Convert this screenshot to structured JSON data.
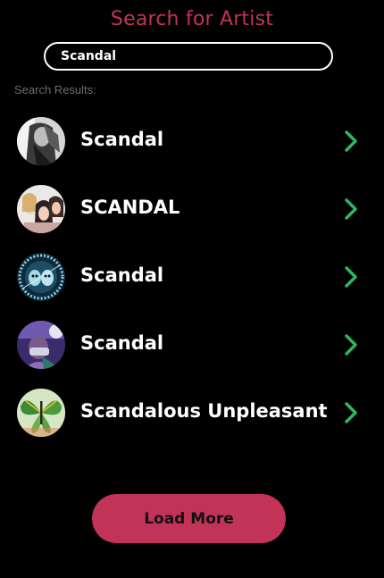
{
  "page_title": "Search for Artist",
  "search": {
    "value": "Scandal"
  },
  "results_label": "Search Results:",
  "results": [
    {
      "name": "Scandal",
      "avatar": "bw-portrait-photo"
    },
    {
      "name": "SCANDAL",
      "avatar": "group-photo"
    },
    {
      "name": "Scandal",
      "avatar": "blue-artwork-photo"
    },
    {
      "name": "Scandal",
      "avatar": "purple-masked-photo"
    },
    {
      "name": "Scandalous Unpleasant",
      "avatar": "green-butterfly-photo"
    }
  ],
  "load_more_label": "Load More",
  "colors": {
    "accent": "#c23358",
    "chevron": "#2fb65e",
    "background": "#000000",
    "muted_text": "#6c6c6c"
  }
}
